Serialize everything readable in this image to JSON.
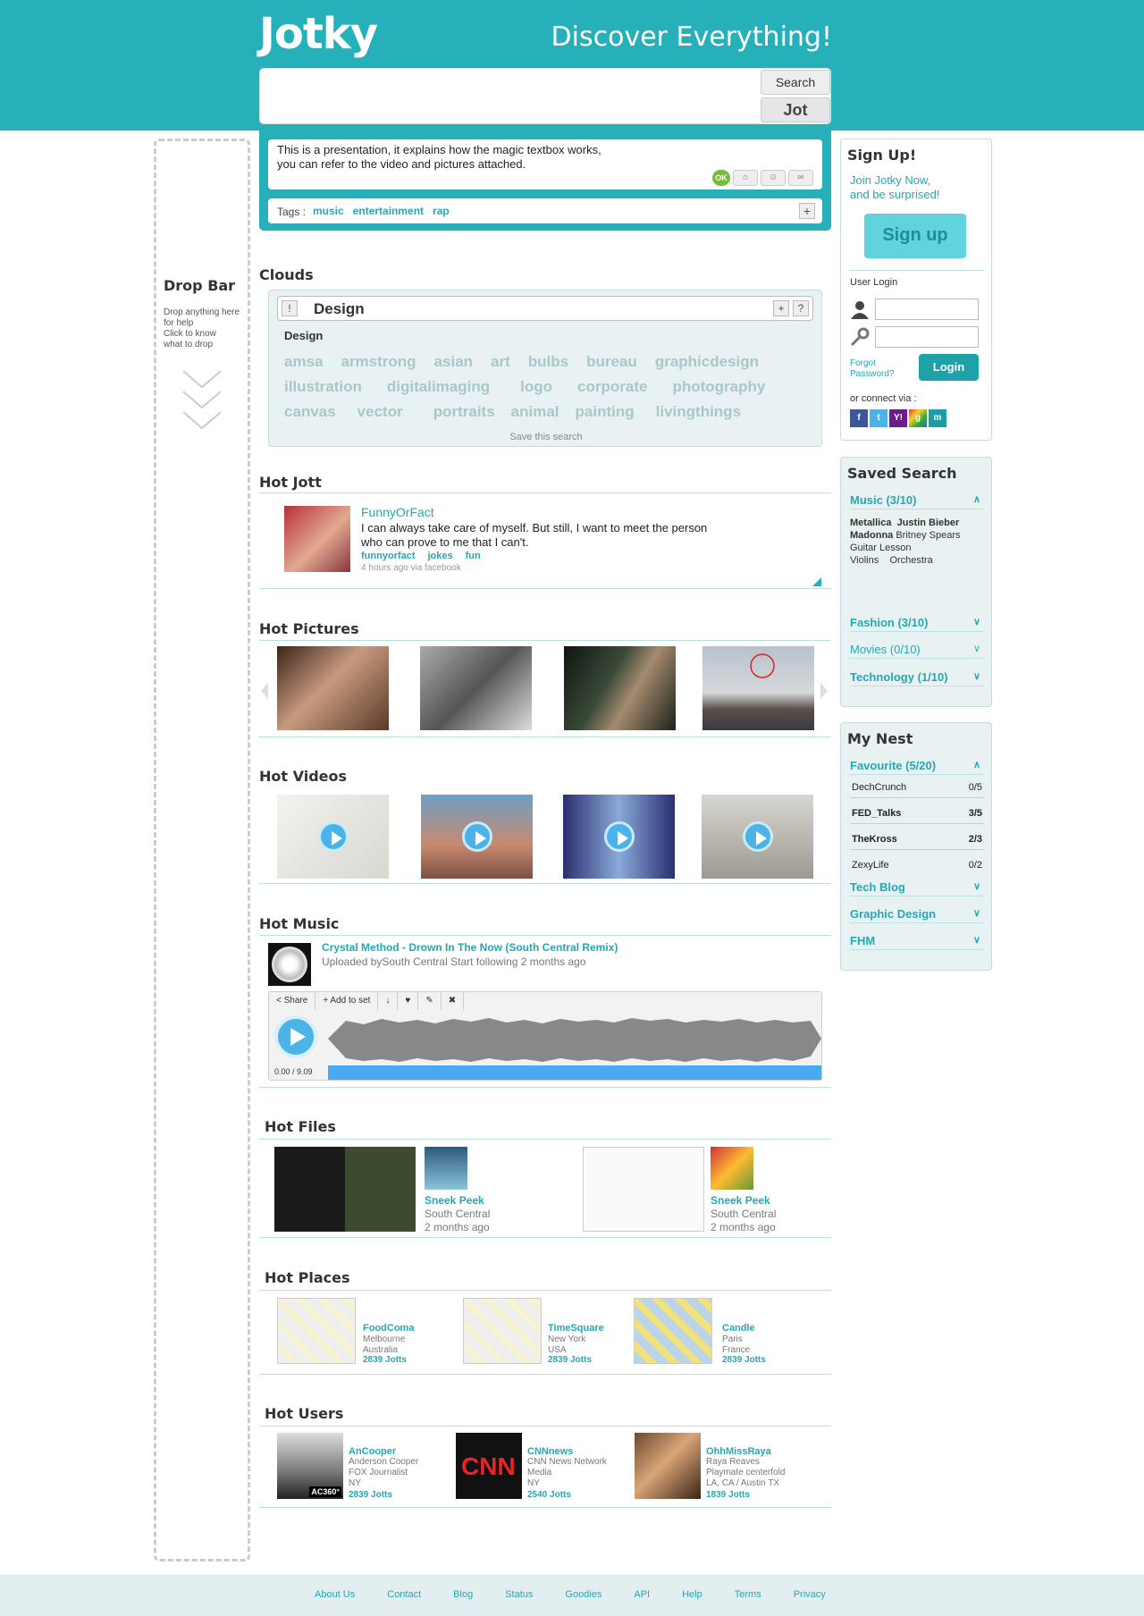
{
  "header": {
    "logo": "Jotky",
    "tagline": "Discover Everything!",
    "search_label": "Search",
    "jot_label": "Jot"
  },
  "dropbar": {
    "title": "Drop Bar",
    "help_lines": [
      "Drop anything here",
      "for help",
      "Click to know",
      "what to drop"
    ]
  },
  "jot": {
    "text_line1": "This is a presentation, it explains how the magic textbox works,",
    "text_line2": "you can refer to the video and pictures attached.",
    "ok_label": "OK",
    "tags_label": "Tags :",
    "tags": [
      "music",
      "entertainment",
      "rap"
    ],
    "plus": "+"
  },
  "clouds": {
    "section": "Clouds",
    "head_title": "Design",
    "bang": "!",
    "plus": "+",
    "help": "?",
    "subtitle": "Design",
    "words": [
      [
        "amsa",
        "armstrong",
        "asian",
        "art",
        "bulbs",
        "bureau",
        "graphicdesign"
      ],
      [
        "illustration",
        "digitalimaging",
        "logo",
        "corporate",
        "photography"
      ],
      [
        "canvas",
        "vector",
        "portraits",
        "animal",
        "painting",
        "livingthings"
      ]
    ],
    "save": "Save this search"
  },
  "hot_jott": {
    "section": "Hot Jott",
    "user": "FunnyOrFact",
    "line1": "I can always take care of myself. But still, I want to meet the person",
    "line2": "who can prove to me that I can't.",
    "tags": [
      "funnyorfact",
      "jokes",
      "fun"
    ],
    "time": "4 hours ago via facebook"
  },
  "hot_pictures": {
    "section": "Hot Pictures"
  },
  "hot_videos": {
    "section": "Hot Videos"
  },
  "hot_music": {
    "section": "Hot Music",
    "title": "Crystal Method - Drown In The Now (South Central Remix)",
    "sub": "Uploaded bySouth Central Start following 2 months ago",
    "share": "Share",
    "add_to_set": "Add to set",
    "time": "0.00 / 9.09"
  },
  "hot_files": {
    "section": "Hot Files",
    "items": [
      {
        "title": "Sneek Peek",
        "by": "South Central",
        "time": "2 months ago"
      },
      {
        "title": "Sneek Peek",
        "by": "South Central",
        "time": "2 months ago"
      }
    ]
  },
  "hot_places": {
    "section": "Hot Places",
    "items": [
      {
        "name": "FoodComa",
        "l1": "Melbourne",
        "l2": "Australia",
        "jotts": "2839 Jotts"
      },
      {
        "name": "TimeSquare",
        "l1": "New York",
        "l2": "USA",
        "jotts": "2839 Jotts"
      },
      {
        "name": "Candle",
        "l1": "Paris",
        "l2": "France",
        "jotts": "2839 Jotts"
      }
    ]
  },
  "hot_users": {
    "section": "Hot Users",
    "items": [
      {
        "handle": "AnCooper",
        "l1": "Anderson Cooper",
        "l2": "FOX Journalist",
        "l3": "NY",
        "jotts": "2839 Jotts",
        "badge": "AC360°"
      },
      {
        "handle": "CNNnews",
        "l1": "CNN News Network",
        "l2": "Media",
        "l3": "NY",
        "jotts": "2540 Jotts",
        "badge": "CNN"
      },
      {
        "handle": "OhhMissRaya",
        "l1": "Raya Reaves",
        "l2": "Playmate centerfold",
        "l3": "LA, CA / Austin TX",
        "jotts": "1839 Jotts"
      }
    ]
  },
  "signup": {
    "title": "Sign Up!",
    "msg1": "Join Jotky Now,",
    "msg2": "and be surprised!",
    "button": "Sign up",
    "user_login": "User Login",
    "forgot1": "Forgot",
    "forgot2": "Password?",
    "login": "Login",
    "connect": "or connect via :"
  },
  "saved_search": {
    "title": "Saved Search",
    "music": "Music  (3/10)",
    "list": [
      [
        "Metallica",
        "Justin Bieber"
      ],
      [
        "Madonna",
        "Britney Spears"
      ],
      [
        "Guitar Lesson",
        ""
      ],
      [
        "Violins",
        "Orchestra"
      ]
    ],
    "fashion": "Fashion  (3/10)",
    "movies": "Movies (0/10)",
    "technology": "Technology (1/10)"
  },
  "nest": {
    "title": "My Nest",
    "favourite": "Favourite  (5/20)",
    "rows": [
      {
        "n": "DechCrunch",
        "c": "0/5"
      },
      {
        "n": "FED_Talks",
        "c": "3/5"
      },
      {
        "n": "TheKross",
        "c": "2/3"
      },
      {
        "n": "ZexyLife",
        "c": "0/2"
      }
    ],
    "tech_blog": "Tech Blog",
    "graphic_design": "Graphic Design",
    "fhm": "FHM"
  },
  "footer": {
    "links": [
      "About Us",
      "Contact",
      "Blog",
      "Status",
      "Goodies",
      "API",
      "Help",
      "Terms",
      "Privacy"
    ]
  }
}
